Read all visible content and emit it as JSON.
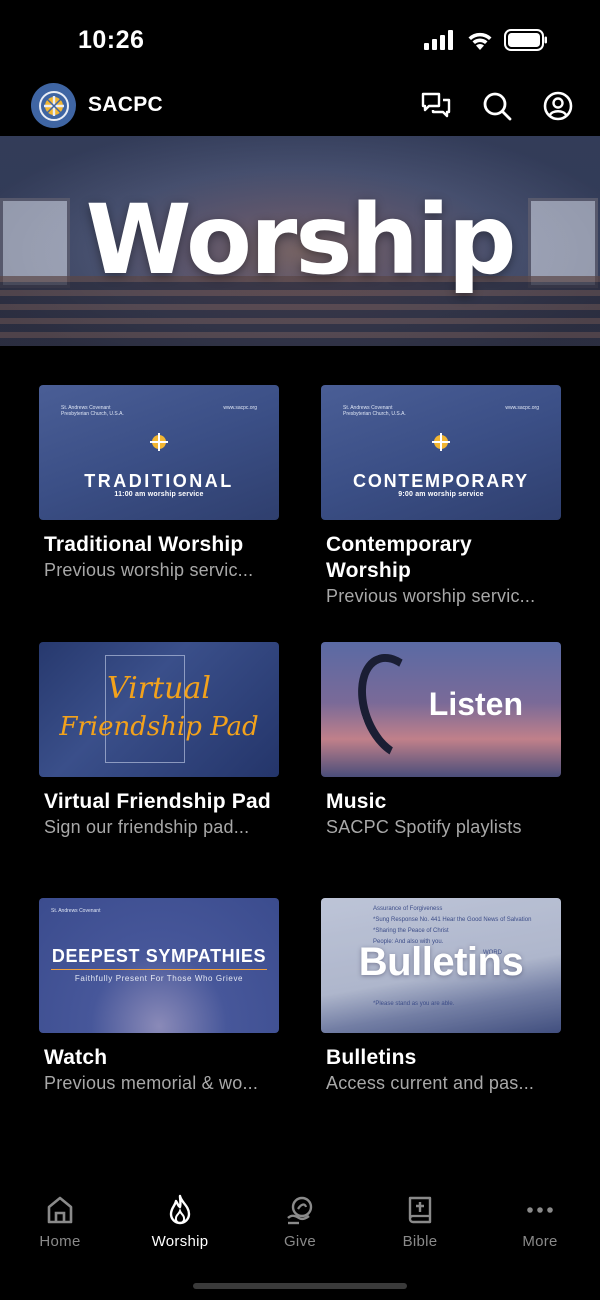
{
  "status_bar": {
    "time": "10:26",
    "icons": [
      "cellular-signal-icon",
      "wifi-icon",
      "battery-icon"
    ]
  },
  "header": {
    "app_name": "SACPC",
    "actions": [
      "chat-icon",
      "search-icon",
      "profile-icon"
    ]
  },
  "hero": {
    "title": "Worship"
  },
  "cards": [
    {
      "title": "Traditional Worship",
      "subtitle": "Previous worship servic...",
      "thumb": {
        "church": "St. Andrews Covenant\nPresbyterian Church, U.S.A.",
        "site": "www.sacpc.org",
        "label": "TRADITIONAL",
        "time": "11:00 am  worship service"
      }
    },
    {
      "title": "Contemporary Worship",
      "subtitle": "Previous worship servic...",
      "thumb": {
        "church": "St. Andrews Covenant\nPresbyterian Church, U.S.A.",
        "site": "www.sacpc.org",
        "label": "CONTEMPORARY",
        "time": "9:00 am  worship service"
      }
    },
    {
      "title": "Virtual Friendship Pad",
      "subtitle": "Sign our friendship pad...",
      "thumb": {
        "text_line1": "Virtual",
        "text_line2": "Friendship Pad"
      }
    },
    {
      "title": "Music",
      "subtitle": "SACPC Spotify playlists",
      "thumb": {
        "text": "Listen"
      }
    },
    {
      "title": "Watch",
      "subtitle": "Previous memorial & wo...",
      "thumb": {
        "brand": "St. Andrews Covenant",
        "headline": "DEEPEST SYMPATHIES",
        "tagline": "Faithfully Present For Those Who Grieve"
      }
    },
    {
      "title": "Bulletins",
      "subtitle": "Access current and pas...",
      "thumb": {
        "text": "Bulletins",
        "lines": [
          "Assurance of Forgiveness",
          "*Sung Response No. 441 Hear the Good News of Salvation",
          "*Sharing the Peace of Christ",
          "People: And also with you.",
          "WORD",
          "*Please stand as you are able."
        ]
      }
    }
  ],
  "tabs": [
    {
      "label": "Home",
      "icon": "home-icon",
      "active": false
    },
    {
      "label": "Worship",
      "icon": "flame-icon",
      "active": true
    },
    {
      "label": "Give",
      "icon": "give-icon",
      "active": false
    },
    {
      "label": "Bible",
      "icon": "bible-icon",
      "active": false
    },
    {
      "label": "More",
      "icon": "more-icon",
      "active": false
    }
  ],
  "colors": {
    "background": "#000000",
    "subtitle_gray": "#a8a8a8",
    "inactive_tab": "#8a8a8a",
    "logo_blue": "#3f65a3",
    "accent_orange": "#f3a21b"
  }
}
